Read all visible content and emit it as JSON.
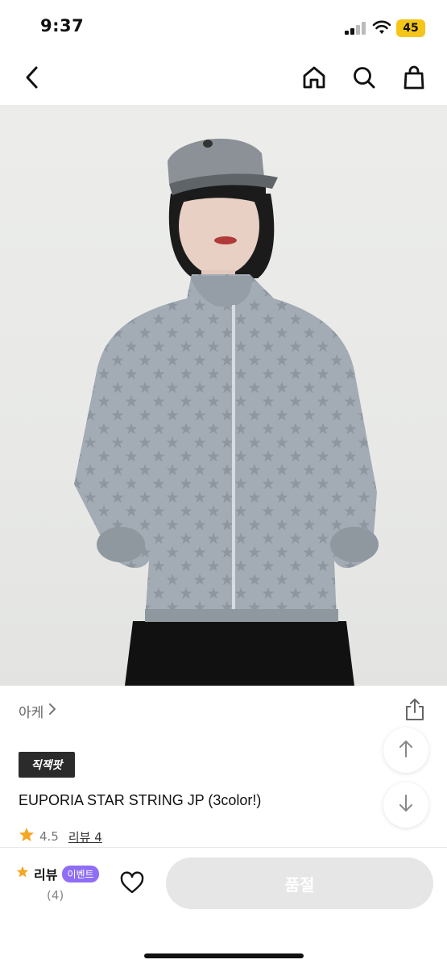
{
  "status_bar": {
    "time": "9:37",
    "battery": "45",
    "icons": [
      "signal-icon",
      "wifi-icon",
      "battery-icon"
    ]
  },
  "nav": {
    "icons": [
      "back-arrow-icon",
      "home-icon",
      "search-icon",
      "shopping-bag-icon"
    ]
  },
  "product": {
    "brand": "아케",
    "badge": "직잭팟",
    "title": "EUPORIA STAR STRING JP (3color!)",
    "rating": "4.5",
    "review_link": "리뷰 4"
  },
  "bottom_bar": {
    "review_label": "리뷰",
    "event_badge": "이벤트",
    "review_count": "(4)",
    "soldout_label": "품절"
  },
  "colors": {
    "accent_purple": "#8f6ef5",
    "star": "#f5a623",
    "battery": "#f5c518",
    "disabled_button": "#e6e6e6"
  }
}
